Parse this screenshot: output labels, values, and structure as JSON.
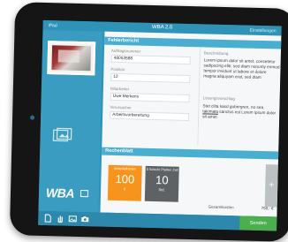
{
  "app": {
    "status_left": "iPad",
    "title": "WBA 2.0",
    "status_right": "Einstellungen"
  },
  "sidebar": {
    "logo_text": "WBA"
  },
  "fehlerbericht": {
    "header": "Fehlerbericht",
    "fields": [
      {
        "label": "Auftragsnummer",
        "value": "48053588"
      },
      {
        "label": "Position",
        "value": "12"
      },
      {
        "label": "Mitarbeiter",
        "value": "Uwe Merkens"
      },
      {
        "label": "Verursacher",
        "value": "Arbeitsvorbereitung"
      }
    ],
    "beschreibung_label": "Beschreibung",
    "beschreibung_text": "Lorem ipsum dolor sit amet, consetetur sadipscing elitr, sed diam nonumy eirmod tempor invidunt ut labore et dolore magna aliquyam erat, sed diam",
    "loesung_label": "Lösungsvorschlag",
    "loesung_text_pre": "Stet clita kasd gubergren, no sea ",
    "loesung_text_link": "takimata",
    "loesung_text_post": " sanctus est Lorem ipsum dolor sit amet."
  },
  "rechenblatt": {
    "header": "Rechenblatt",
    "buckets": [
      {
        "label": "Materialkosten",
        "value": "100",
        "unit": "€",
        "color": "#f7941d"
      },
      {
        "label": "5 Schicht Platten Zeit",
        "value": "10",
        "unit": "Std.",
        "color": "#5f6264"
      }
    ],
    "add_label": "+",
    "total_label": "Gesamtkosten",
    "total_value": "750,- €"
  },
  "toolbar": {
    "icons": [
      "document-icon",
      "hand-icon",
      "image-icon",
      "camera-icon"
    ],
    "send_label": "Senden"
  }
}
